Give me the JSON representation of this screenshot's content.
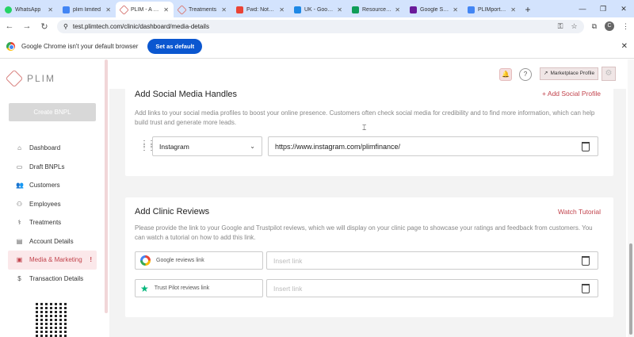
{
  "browser": {
    "tabs": [
      {
        "label": "WhatsApp",
        "color": "#25d366"
      },
      {
        "label": "plim limited",
        "color": "#4285f4"
      },
      {
        "label": "PLIM - A Pay",
        "color": "#d9827f",
        "active": true
      },
      {
        "label": "Treatments",
        "color": "#d9827f"
      },
      {
        "label": "Fwd: Notes:",
        "color": "#ea4335"
      },
      {
        "label": "UK - Google",
        "color": "#1e88e5"
      },
      {
        "label": "Resource Ca",
        "color": "#0f9d58"
      },
      {
        "label": "Google Sear",
        "color": "#6a1b9a"
      },
      {
        "label": "PLIMportal A",
        "color": "#4285f4"
      }
    ],
    "url": "test.plimtech.com/clinic/dashboard/media-details",
    "infobar_text": "Google Chrome isn't your default browser",
    "set_default_label": "Set as default",
    "profile_initial": "C"
  },
  "sidebar": {
    "brand": "PLIM",
    "create_label": "Create BNPL",
    "items": [
      {
        "label": "Dashboard",
        "icon": "⌂"
      },
      {
        "label": "Draft BNPLs",
        "icon": "▭"
      },
      {
        "label": "Customers",
        "icon": "👥"
      },
      {
        "label": "Employees",
        "icon": "⚇"
      },
      {
        "label": "Treatments",
        "icon": "⚕"
      },
      {
        "label": "Account Details",
        "icon": "▤"
      },
      {
        "label": "Media & Marketing",
        "icon": "▣",
        "active": true,
        "alert": "!"
      },
      {
        "label": "Transaction Details",
        "icon": "$"
      }
    ]
  },
  "header": {
    "marketplace_label": "Marketplace Profile"
  },
  "social": {
    "title": "Add Social Media Handles",
    "add_label": "+ Add Social Profile",
    "description": "Add links to your social media profiles to boost your online presence. Customers often check social media for credibility and to find more information, which can help build trust and generate more leads.",
    "platform": "Instagram",
    "url": "https://www.instagram.com/plimfinance/"
  },
  "reviews": {
    "title": "Add Clinic Reviews",
    "tutorial_label": "Watch Tutorial",
    "description": "Please provide the link to your Google and Trustpilot reviews, which we will display on your clinic page to showcase your ratings and feedback from customers. You can watch a tutorial on how to add this link.",
    "google_label": "Google reviews link",
    "trustpilot_label": "Trust Pilot reviews link",
    "placeholder": "Insert link"
  }
}
